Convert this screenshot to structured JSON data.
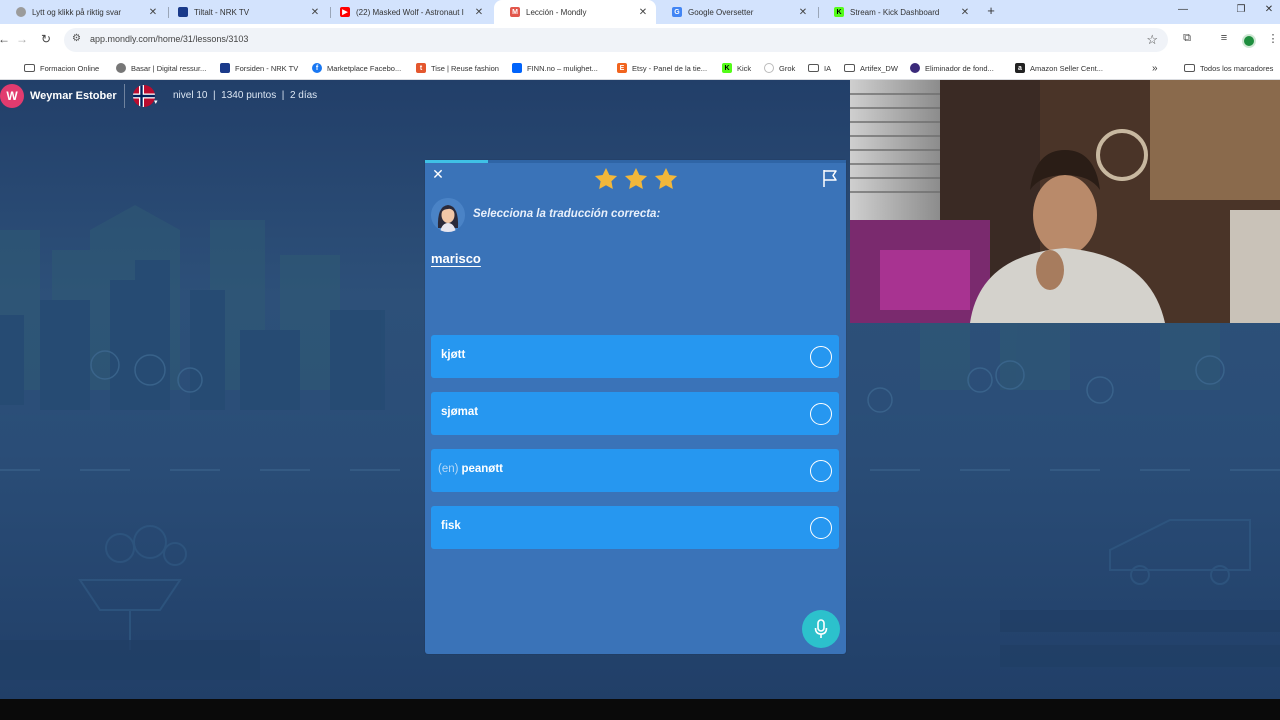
{
  "browser": {
    "tabs": [
      {
        "title": "Lytt og klikk på riktig svar",
        "favicon": "globe-icon",
        "favicon_color": "#8a8a8a"
      },
      {
        "title": "Tiltalt - NRK TV",
        "favicon": "nrk-icon",
        "favicon_color": "#1a3a8a"
      },
      {
        "title": "(22) Masked Wolf - Astronaut I",
        "favicon": "youtube-icon",
        "favicon_color": "#ff0000"
      },
      {
        "title": "Lección - Mondly",
        "favicon": "mondly-icon",
        "favicon_color": "#e2574c"
      },
      {
        "title": "Google Oversetter",
        "favicon": "google-translate-icon",
        "favicon_color": "#4285f4"
      },
      {
        "title": "Stream - Kick Dashboard",
        "favicon": "kick-icon",
        "favicon_color": "#53fc18"
      }
    ],
    "active_tab": 3,
    "url": "app.mondly.com/home/31/lessons/3103",
    "bookmarks": [
      {
        "label": "Formacion Online",
        "icon": "folder-icon"
      },
      {
        "label": "Basar | Digital ressur...",
        "icon": "gear-icon"
      },
      {
        "label": "Forsiden - NRK TV",
        "icon": "nrk-icon"
      },
      {
        "label": "Marketplace Facebo...",
        "icon": "facebook-icon"
      },
      {
        "label": "Tise | Reuse fashion",
        "icon": "tise-icon"
      },
      {
        "label": "FINN.no – mulighet...",
        "icon": "finn-icon"
      },
      {
        "label": "Etsy - Panel de la tie...",
        "icon": "etsy-icon"
      },
      {
        "label": "Kick",
        "icon": "kick-icon"
      },
      {
        "label": "Grok",
        "icon": "grok-icon"
      },
      {
        "label": "IA",
        "icon": "folder-icon"
      },
      {
        "label": "Artifex_DW",
        "icon": "folder-icon"
      },
      {
        "label": "Eliminador de fond...",
        "icon": "remove-bg-icon"
      },
      {
        "label": "Amazon Seller Cent...",
        "icon": "amazon-icon"
      }
    ],
    "more_bookmarks": "»",
    "all_bookmarks": "Todos los marcadores"
  },
  "user": {
    "initial": "W",
    "name": "Weymar Estober",
    "stats": "nivel 10  |  1340 puntos  |  2 días",
    "language_flag": "norway-flag"
  },
  "lesson": {
    "progress": 0.15,
    "stars": 3,
    "instruction": "Selecciona la traducción correcta:",
    "word": "marisco",
    "options": [
      {
        "article": "",
        "text": "kjøtt"
      },
      {
        "article": "",
        "text": "sjømat"
      },
      {
        "article": "(en)",
        "text": "peanøtt"
      },
      {
        "article": "",
        "text": "fisk"
      }
    ]
  },
  "colors": {
    "page_bg": "#234470",
    "card_bg": "#3a73b8",
    "option_bg": "#2697f0",
    "mic_bg": "#2cc1cc",
    "star": "#f2b73a",
    "avatar_bg": "#e23b6f"
  }
}
